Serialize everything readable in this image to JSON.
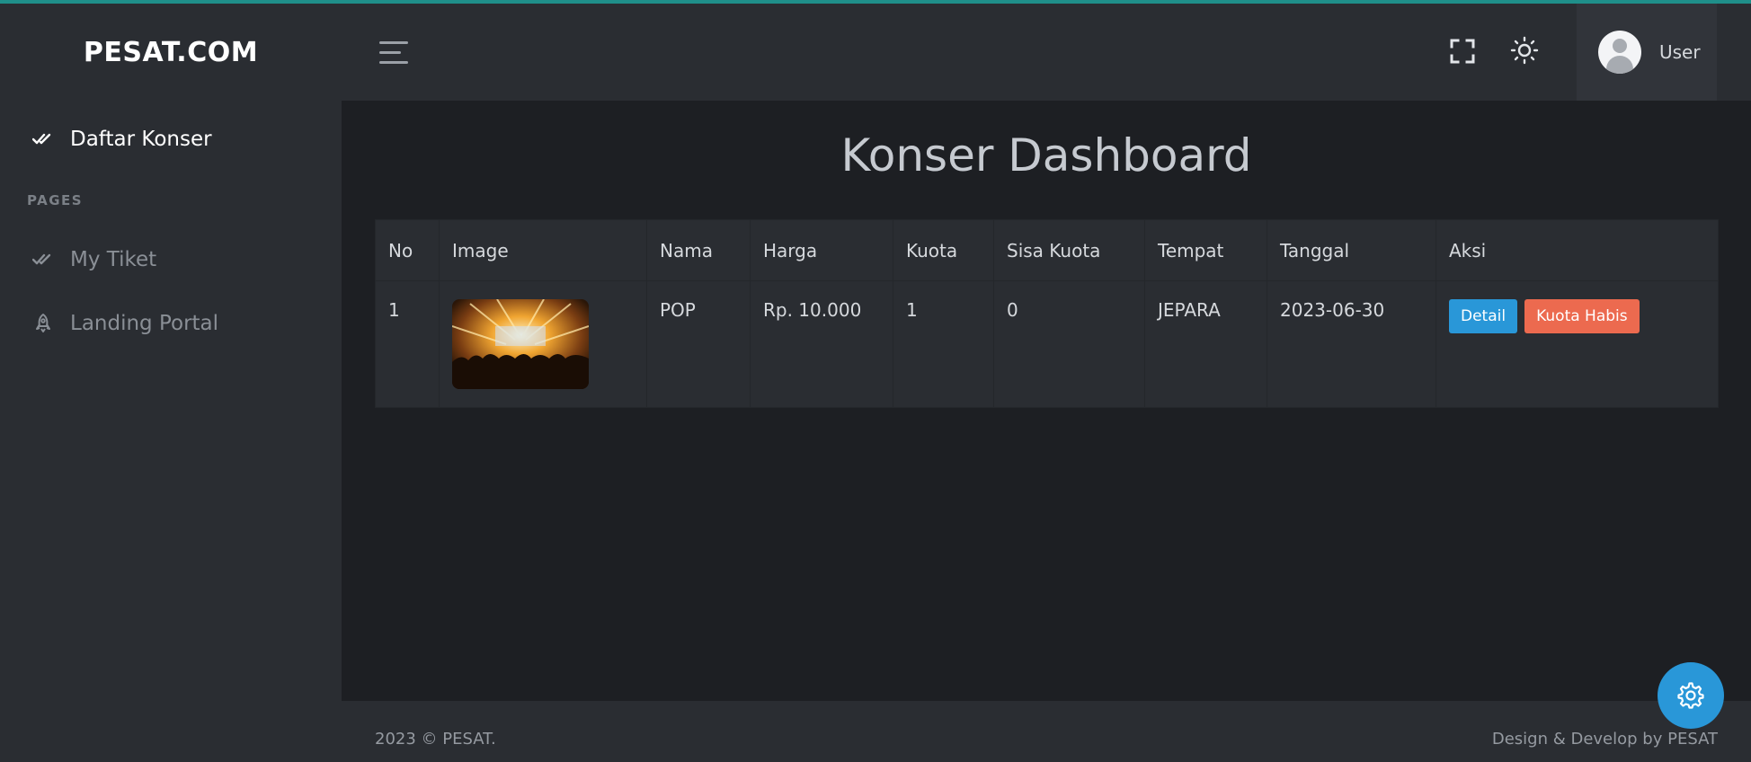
{
  "app": {
    "brand": "PESAT.COM"
  },
  "sidebar": {
    "items": [
      {
        "label": "Daftar Konser",
        "icon": "double-check-icon"
      }
    ],
    "pages_heading": "PAGES",
    "pages": [
      {
        "label": "My Tiket",
        "icon": "double-check-icon"
      },
      {
        "label": "Landing Portal",
        "icon": "rocket-icon"
      }
    ]
  },
  "header": {
    "user_name": "User",
    "icons": [
      "menu-icon",
      "fullscreen-icon",
      "sun-icon",
      "user-avatar"
    ]
  },
  "main": {
    "title": "Konser Dashboard",
    "table": {
      "headers": [
        "No",
        "Image",
        "Nama",
        "Harga",
        "Kuota",
        "Sisa Kuota",
        "Tempat",
        "Tanggal",
        "Aksi"
      ],
      "rows": [
        {
          "no": "1",
          "image": "concert-photo",
          "nama": "POP",
          "harga": "Rp. 10.000",
          "kuota": "1",
          "sisa_kuota": "0",
          "tempat": "JEPARA",
          "tanggal": "2023-06-30",
          "actions": {
            "detail": "Detail",
            "status": "Kuota Habis"
          }
        }
      ]
    }
  },
  "footer": {
    "left": "2023 © PESAT.",
    "right": "Design & Develop by PESAT"
  },
  "colors": {
    "accent": "#2997d8",
    "danger": "#ec6a4f",
    "sidebar_bg": "#2a2d32",
    "page_bg": "#1d1f23",
    "top_line": "#1f8f8a"
  }
}
